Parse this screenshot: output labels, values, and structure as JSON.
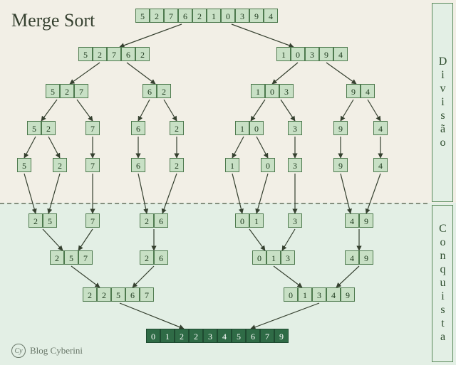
{
  "title": "Merge Sort",
  "phase_labels": {
    "divide": "Divisão",
    "conquer": "Conquista"
  },
  "footer": {
    "logo": "Cy",
    "text": "Blog Cyberini"
  },
  "colors": {
    "bg_divide": "#f2efe6",
    "bg_conquer": "#e3efe5",
    "cell_bg": "#c8e0c5",
    "cell_border": "#4e7a4e",
    "result_bg": "#2f6b46",
    "arrow": "#35402f"
  },
  "divide": {
    "L0": {
      "v": [
        "5",
        "2",
        "7",
        "6",
        "2",
        "1",
        "0",
        "3",
        "9",
        "4"
      ]
    },
    "L1": [
      {
        "v": [
          "5",
          "2",
          "7",
          "6",
          "2"
        ]
      },
      {
        "v": [
          "1",
          "0",
          "3",
          "9",
          "4"
        ]
      }
    ],
    "L2": [
      {
        "v": [
          "5",
          "2",
          "7"
        ]
      },
      {
        "v": [
          "6",
          "2"
        ]
      },
      {
        "v": [
          "1",
          "0",
          "3"
        ]
      },
      {
        "v": [
          "9",
          "4"
        ]
      }
    ],
    "L3": [
      {
        "v": [
          "5",
          "2"
        ]
      },
      {
        "v": [
          "7"
        ]
      },
      {
        "v": [
          "6"
        ]
      },
      {
        "v": [
          "2"
        ]
      },
      {
        "v": [
          "1",
          "0"
        ]
      },
      {
        "v": [
          "3"
        ]
      },
      {
        "v": [
          "9"
        ]
      },
      {
        "v": [
          "4"
        ]
      }
    ],
    "L4": [
      {
        "v": [
          "5"
        ]
      },
      {
        "v": [
          "2"
        ]
      },
      {
        "v": [
          "7"
        ]
      },
      {
        "v": [
          "6"
        ]
      },
      {
        "v": [
          "2"
        ]
      },
      {
        "v": [
          "1"
        ]
      },
      {
        "v": [
          "0"
        ]
      },
      {
        "v": [
          "3"
        ]
      },
      {
        "v": [
          "9"
        ]
      },
      {
        "v": [
          "4"
        ]
      }
    ]
  },
  "conquer": {
    "C1": [
      {
        "v": [
          "2",
          "5"
        ]
      },
      {
        "v": [
          "7"
        ]
      },
      {
        "v": [
          "2",
          "6"
        ]
      },
      {
        "v": [
          "0",
          "1"
        ]
      },
      {
        "v": [
          "3"
        ]
      },
      {
        "v": [
          "4",
          "9"
        ]
      }
    ],
    "C2": [
      {
        "v": [
          "2",
          "5",
          "7"
        ]
      },
      {
        "v": [
          "2",
          "6"
        ]
      },
      {
        "v": [
          "0",
          "1",
          "3"
        ]
      },
      {
        "v": [
          "4",
          "9"
        ]
      }
    ],
    "C3": [
      {
        "v": [
          "2",
          "2",
          "5",
          "6",
          "7"
        ]
      },
      {
        "v": [
          "0",
          "1",
          "3",
          "4",
          "9"
        ]
      }
    ],
    "C4": {
      "v": [
        "0",
        "1",
        "2",
        "2",
        "3",
        "4",
        "5",
        "6",
        "7",
        "9"
      ]
    }
  },
  "chart_data": {
    "type": "table",
    "title": "Merge Sort — divide and conquer trace",
    "input": [
      5,
      2,
      7,
      6,
      2,
      1,
      0,
      3,
      9,
      4
    ],
    "output": [
      0,
      1,
      2,
      2,
      3,
      4,
      5,
      6,
      7,
      9
    ],
    "divide_levels": [
      [
        [
          5,
          2,
          7,
          6,
          2,
          1,
          0,
          3,
          9,
          4
        ]
      ],
      [
        [
          5,
          2,
          7,
          6,
          2
        ],
        [
          1,
          0,
          3,
          9,
          4
        ]
      ],
      [
        [
          5,
          2,
          7
        ],
        [
          6,
          2
        ],
        [
          1,
          0,
          3
        ],
        [
          9,
          4
        ]
      ],
      [
        [
          5,
          2
        ],
        [
          7
        ],
        [
          6
        ],
        [
          2
        ],
        [
          1,
          0
        ],
        [
          3
        ],
        [
          9
        ],
        [
          4
        ]
      ],
      [
        [
          5
        ],
        [
          2
        ],
        [
          7
        ],
        [
          6
        ],
        [
          2
        ],
        [
          1
        ],
        [
          0
        ],
        [
          3
        ],
        [
          9
        ],
        [
          4
        ]
      ]
    ],
    "conquer_levels": [
      [
        [
          2,
          5
        ],
        [
          7
        ],
        [
          2,
          6
        ],
        [
          0,
          1
        ],
        [
          3
        ],
        [
          4,
          9
        ]
      ],
      [
        [
          2,
          5,
          7
        ],
        [
          2,
          6
        ],
        [
          0,
          1,
          3
        ],
        [
          4,
          9
        ]
      ],
      [
        [
          2,
          2,
          5,
          6,
          7
        ],
        [
          0,
          1,
          3,
          4,
          9
        ]
      ],
      [
        [
          0,
          1,
          2,
          2,
          3,
          4,
          5,
          6,
          7,
          9
        ]
      ]
    ]
  }
}
